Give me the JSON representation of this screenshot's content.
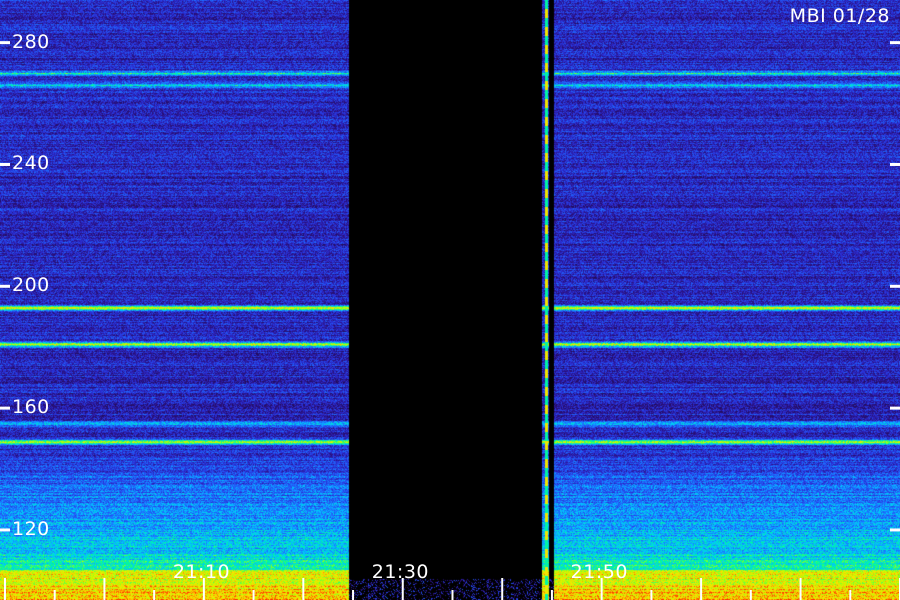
{
  "station_label": "MBI 01/28",
  "colors": {
    "background": "#000000",
    "text": "#ffffff",
    "palette": [
      "#1a0a3c",
      "#2a1080",
      "#2a30d8",
      "#1e6cff",
      "#00c8ff",
      "#00ff90",
      "#b8ff00",
      "#ffe000",
      "#ff3000"
    ]
  },
  "chart_data": {
    "type": "heatmap",
    "title": "",
    "xlabel": "",
    "ylabel": "",
    "x_tick_labels": [
      "21:10",
      "21:30",
      "21:50"
    ],
    "x_ticks_minutes": [
      20.0,
      40.0,
      60.0
    ],
    "xlim_minutes": [
      -0.5,
      90.0
    ],
    "x_axis_origin_clock": "20:50",
    "y_tick_labels": [
      "120",
      "160",
      "200",
      "240",
      "280"
    ],
    "y_ticks": [
      120,
      160,
      200,
      240,
      280
    ],
    "ylim": [
      97,
      294
    ],
    "data_gaps_minutes": [
      [
        34.5,
        54.0
      ],
      [
        54.7,
        55.2
      ]
    ],
    "bright_lines": [
      {
        "y": 193,
        "intensity": 0.6
      },
      {
        "y": 181,
        "intensity": 0.6
      },
      {
        "y": 149,
        "intensity": 0.55
      },
      {
        "y": 270,
        "intensity": 0.35
      },
      {
        "y": 266,
        "intensity": 0.3
      },
      {
        "y": 155,
        "intensity": 0.3
      }
    ],
    "interference_minutes": [
      54.3,
      54.6
    ],
    "grid": false,
    "legend": "none"
  }
}
